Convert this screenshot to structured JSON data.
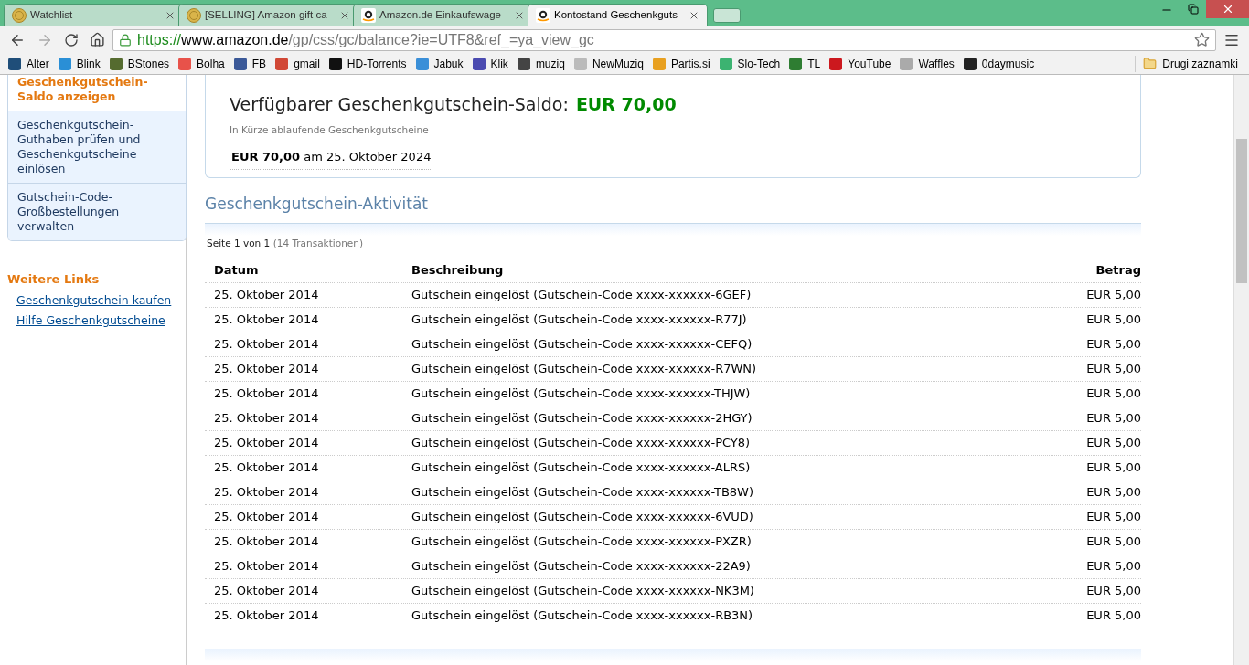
{
  "browser": {
    "tabs": [
      {
        "title": "Watchlist",
        "kind": "coin",
        "selected": false
      },
      {
        "title": "[SELLING] Amazon gift ca",
        "kind": "coin",
        "selected": false
      },
      {
        "title": "Amazon.de Einkaufswage",
        "kind": "amazon",
        "selected": false
      },
      {
        "title": "Kontostand Geschenkguts",
        "kind": "amazon",
        "selected": true
      }
    ],
    "url": {
      "scheme": "https://",
      "host": "www.amazon.de",
      "path": "/gp/css/gc/balance?ie=UTF8&ref_=ya_view_gc"
    },
    "bookmarks": [
      {
        "label": "Alter",
        "color": "#1f4e79"
      },
      {
        "label": "Blink",
        "color": "#2a8fd6"
      },
      {
        "label": "BStones",
        "color": "#556b2f"
      },
      {
        "label": "Bolha",
        "color": "#e8524a"
      },
      {
        "label": "FB",
        "color": "#3b5998"
      },
      {
        "label": "gmail",
        "color": "#d14836"
      },
      {
        "label": "HD-Torrents",
        "color": "#111111"
      },
      {
        "label": "Jabuk",
        "color": "#3a8fd8"
      },
      {
        "label": "Klik",
        "color": "#4a4ab0"
      },
      {
        "label": "muziq",
        "color": "#444444"
      },
      {
        "label": "NewMuziq",
        "color": "#bbbbbb"
      },
      {
        "label": "Partis.si",
        "color": "#e8a020"
      },
      {
        "label": "Slo-Tech",
        "color": "#3cb371"
      },
      {
        "label": "TL",
        "color": "#2e7d32"
      },
      {
        "label": "YouTube",
        "color": "#cc181e"
      },
      {
        "label": "Waffles",
        "color": "#aaaaaa"
      },
      {
        "label": "0daymusic",
        "color": "#222222"
      }
    ],
    "other_bookmarks": "Drugi zaznamki"
  },
  "sidebar": {
    "items": [
      {
        "label": "Geschenkgutschein-Saldo anzeigen",
        "selected": true
      },
      {
        "label": "Geschenkgutschein-Guthaben prüfen und Geschenkgutscheine einlösen",
        "selected": false
      },
      {
        "label": "Gutschein-Code-Großbestellungen verwalten",
        "selected": false
      }
    ],
    "more_links_title": "Weitere Links",
    "more_links": [
      "Geschenkgutschein kaufen",
      "Hilfe Geschenkgutscheine"
    ]
  },
  "balance": {
    "label": "Verfügbarer Geschenkgutschein-Saldo:",
    "amount": "EUR 70,00",
    "expiring_title": "In Kürze ablaufende Geschenkgutscheine",
    "expiring": "**EUR 70,00** am 25. Oktober 2024"
  },
  "activity": {
    "title": "Geschenkgutschein-Aktivität",
    "page_info": "Seite 1 von 1",
    "count": "(14 Transaktionen)",
    "columns": [
      "Datum",
      "Beschreibung",
      "Betrag"
    ],
    "rows": [
      [
        "25. Oktober 2014",
        "Gutschein eingelöst (Gutschein-Code xxxx-xxxxxx-6GEF)",
        "EUR 5,00"
      ],
      [
        "25. Oktober 2014",
        "Gutschein eingelöst (Gutschein-Code xxxx-xxxxxx-R77J)",
        "EUR 5,00"
      ],
      [
        "25. Oktober 2014",
        "Gutschein eingelöst (Gutschein-Code xxxx-xxxxxx-CEFQ)",
        "EUR 5,00"
      ],
      [
        "25. Oktober 2014",
        "Gutschein eingelöst (Gutschein-Code xxxx-xxxxxx-R7WN)",
        "EUR 5,00"
      ],
      [
        "25. Oktober 2014",
        "Gutschein eingelöst (Gutschein-Code xxxx-xxxxxx-THJW)",
        "EUR 5,00"
      ],
      [
        "25. Oktober 2014",
        "Gutschein eingelöst (Gutschein-Code xxxx-xxxxxx-2HGY)",
        "EUR 5,00"
      ],
      [
        "25. Oktober 2014",
        "Gutschein eingelöst (Gutschein-Code xxxx-xxxxxx-PCY8)",
        "EUR 5,00"
      ],
      [
        "25. Oktober 2014",
        "Gutschein eingelöst (Gutschein-Code xxxx-xxxxxx-ALRS)",
        "EUR 5,00"
      ],
      [
        "25. Oktober 2014",
        "Gutschein eingelöst (Gutschein-Code xxxx-xxxxxx-TB8W)",
        "EUR 5,00"
      ],
      [
        "25. Oktober 2014",
        "Gutschein eingelöst (Gutschein-Code xxxx-xxxxxx-6VUD)",
        "EUR 5,00"
      ],
      [
        "25. Oktober 2014",
        "Gutschein eingelöst (Gutschein-Code xxxx-xxxxxx-PXZR)",
        "EUR 5,00"
      ],
      [
        "25. Oktober 2014",
        "Gutschein eingelöst (Gutschein-Code xxxx-xxxxxx-22A9)",
        "EUR 5,00"
      ],
      [
        "25. Oktober 2014",
        "Gutschein eingelöst (Gutschein-Code xxxx-xxxxxx-NK3M)",
        "EUR 5,00"
      ],
      [
        "25. Oktober 2014",
        "Gutschein eingelöst (Gutschein-Code xxxx-xxxxxx-RB3N)",
        "EUR 5,00"
      ]
    ]
  }
}
